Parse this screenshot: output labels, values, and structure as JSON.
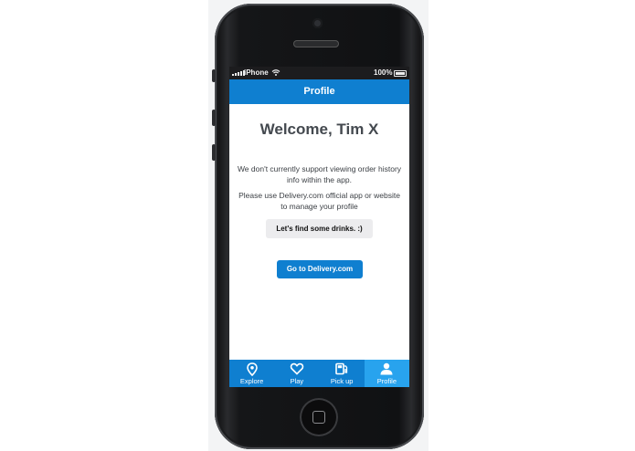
{
  "status_bar": {
    "carrier": "iPhone",
    "battery": "100%"
  },
  "header": {
    "title": "Profile"
  },
  "main": {
    "welcome": "Welcome, Tim X",
    "message_1": "We don't currently support viewing order history info within the app.",
    "message_2": "Please use Delivery.com official app or website to manage your profile",
    "drinks_button": "Let's find some drinks. :)",
    "delivery_button": "Go to Delivery.com"
  },
  "tabs": [
    {
      "label": "Explore",
      "icon": "map-pin-icon"
    },
    {
      "label": "Play",
      "icon": "heart-icon"
    },
    {
      "label": "Pick up",
      "icon": "fuel-pump-icon"
    },
    {
      "label": "Profile",
      "icon": "person-icon",
      "active": true
    }
  ],
  "colors": {
    "accent": "#0f7fd0",
    "active_tab": "#28a3ee"
  }
}
